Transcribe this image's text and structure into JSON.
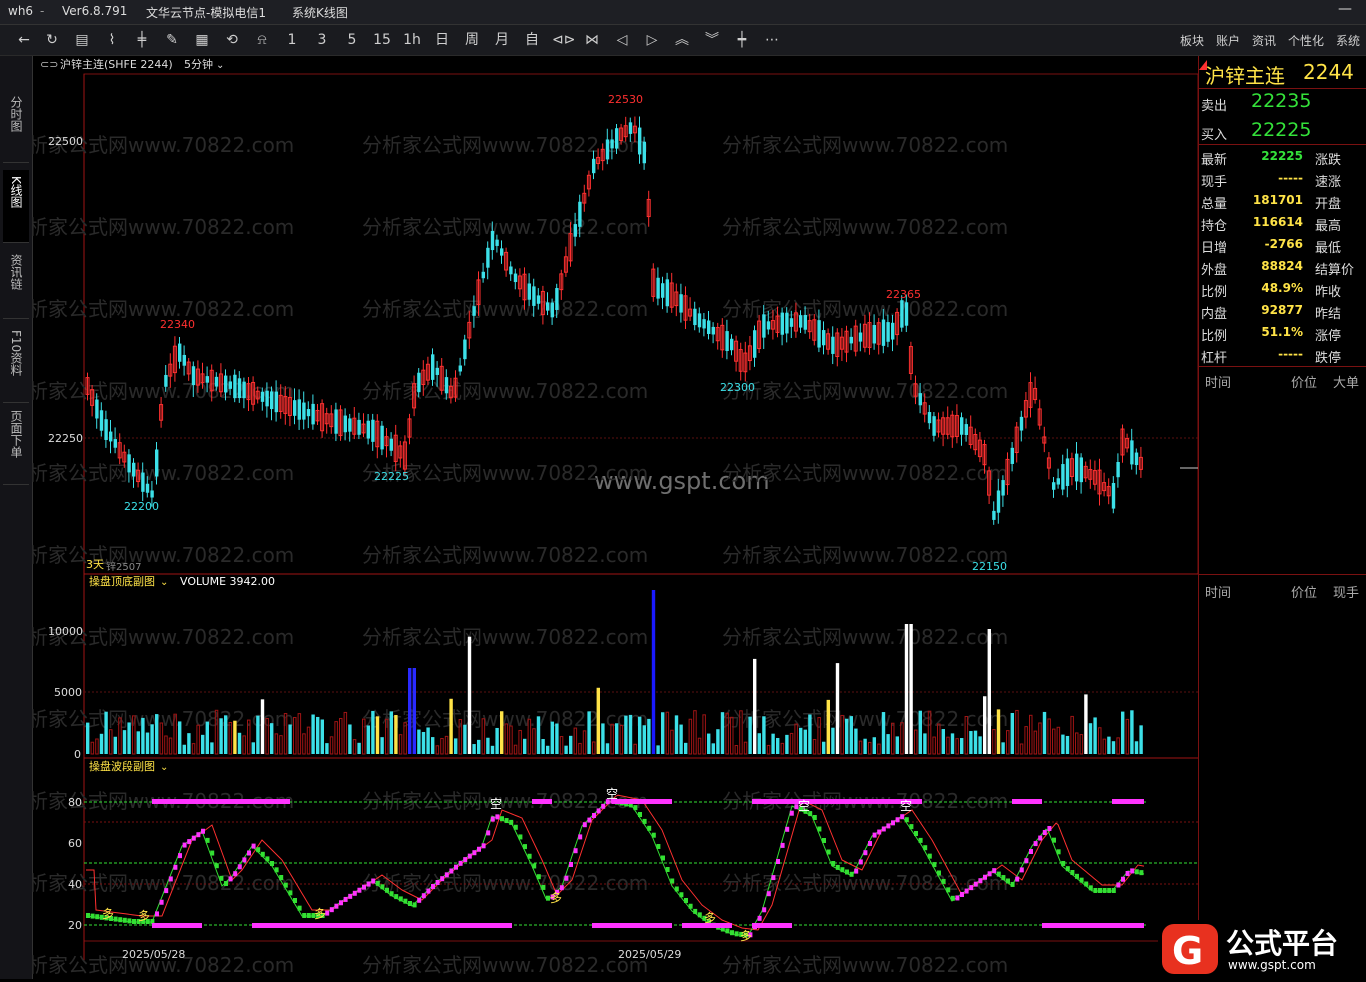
{
  "app": {
    "name": "wh6",
    "version": "Ver6.8.791",
    "node": "文华云节点-模拟电信1",
    "view": "系统K线图"
  },
  "toolbar": {
    "periods": [
      "1",
      "3",
      "5",
      "15",
      "1h",
      "日",
      "周",
      "月",
      "自"
    ],
    "right_menu": [
      "板块",
      "账户",
      "资讯",
      "个性化",
      "系统"
    ]
  },
  "left_tabs": [
    {
      "label": "分时图"
    },
    {
      "label": "K线图"
    },
    {
      "label": "资讯链"
    },
    {
      "label": "F10资料"
    },
    {
      "label": "页面下单"
    }
  ],
  "chart_header": {
    "symbol": "沪锌主连(SHFE 2244)",
    "period": "5分钟"
  },
  "watermarks": {
    "main": "www.gspt.com",
    "repeat": "分析家公式网www.70822.com"
  },
  "main_chart": {
    "price_ticks": [
      "22500",
      "22250"
    ],
    "labels": {
      "l22200": "22200",
      "l22340": "22340",
      "l22225": "22225",
      "l22530": "22530",
      "l22300": "22300",
      "l22365": "22365",
      "l22150": "22150"
    },
    "footer_note": "3天",
    "footer_sym": "锌2507"
  },
  "volume_panel": {
    "title": "操盘顶底副图",
    "indicator": "VOLUME 3942.00",
    "ticks": [
      "10000",
      "5000",
      "0"
    ]
  },
  "wave_panel": {
    "title": "操盘波段副图",
    "ticks": [
      "80",
      "60",
      "40",
      "20"
    ],
    "signal_long": "多",
    "signal_short": "空"
  },
  "dates": [
    "2025/05/28",
    "2025/05/29"
  ],
  "quote": {
    "name": "沪锌主连",
    "price": "2244",
    "sell_label": "卖出",
    "sell": "22235",
    "buy_label": "买入",
    "buy": "22225",
    "rows": [
      {
        "k": "最新",
        "v": "22225",
        "r": "涨跌",
        "c": "grn"
      },
      {
        "k": "现手",
        "v": "-----",
        "r": "速涨",
        "c": "yel"
      },
      {
        "k": "总量",
        "v": "181701",
        "r": "开盘",
        "c": "yel"
      },
      {
        "k": "持仓",
        "v": "116614",
        "r": "最高",
        "c": "yel"
      },
      {
        "k": "日增",
        "v": "-2766",
        "r": "最低",
        "c": "yel"
      },
      {
        "k": "外盘",
        "v": "88824",
        "r": "结算价",
        "c": "yel"
      },
      {
        "k": "比例",
        "v": "48.9%",
        "r": "昨收",
        "c": "yel"
      },
      {
        "k": "内盘",
        "v": "92877",
        "r": "昨结",
        "c": "yel"
      },
      {
        "k": "比例",
        "v": "51.1%",
        "r": "涨停",
        "c": "yel"
      },
      {
        "k": "杠杆",
        "v": "-----",
        "r": "跌停",
        "c": "yel"
      }
    ],
    "tick_header1": [
      "时间",
      "价位",
      "大单"
    ],
    "tick_header2": [
      "时间",
      "价位",
      "现手"
    ]
  },
  "logo": {
    "text": "公式平台",
    "url_text": "www.gspt.com"
  },
  "colors": {
    "up": "#ff3030",
    "down": "#3ce0e8",
    "accent": "#ffe347",
    "magenta": "#ff33ff",
    "green": "#33e033"
  }
}
